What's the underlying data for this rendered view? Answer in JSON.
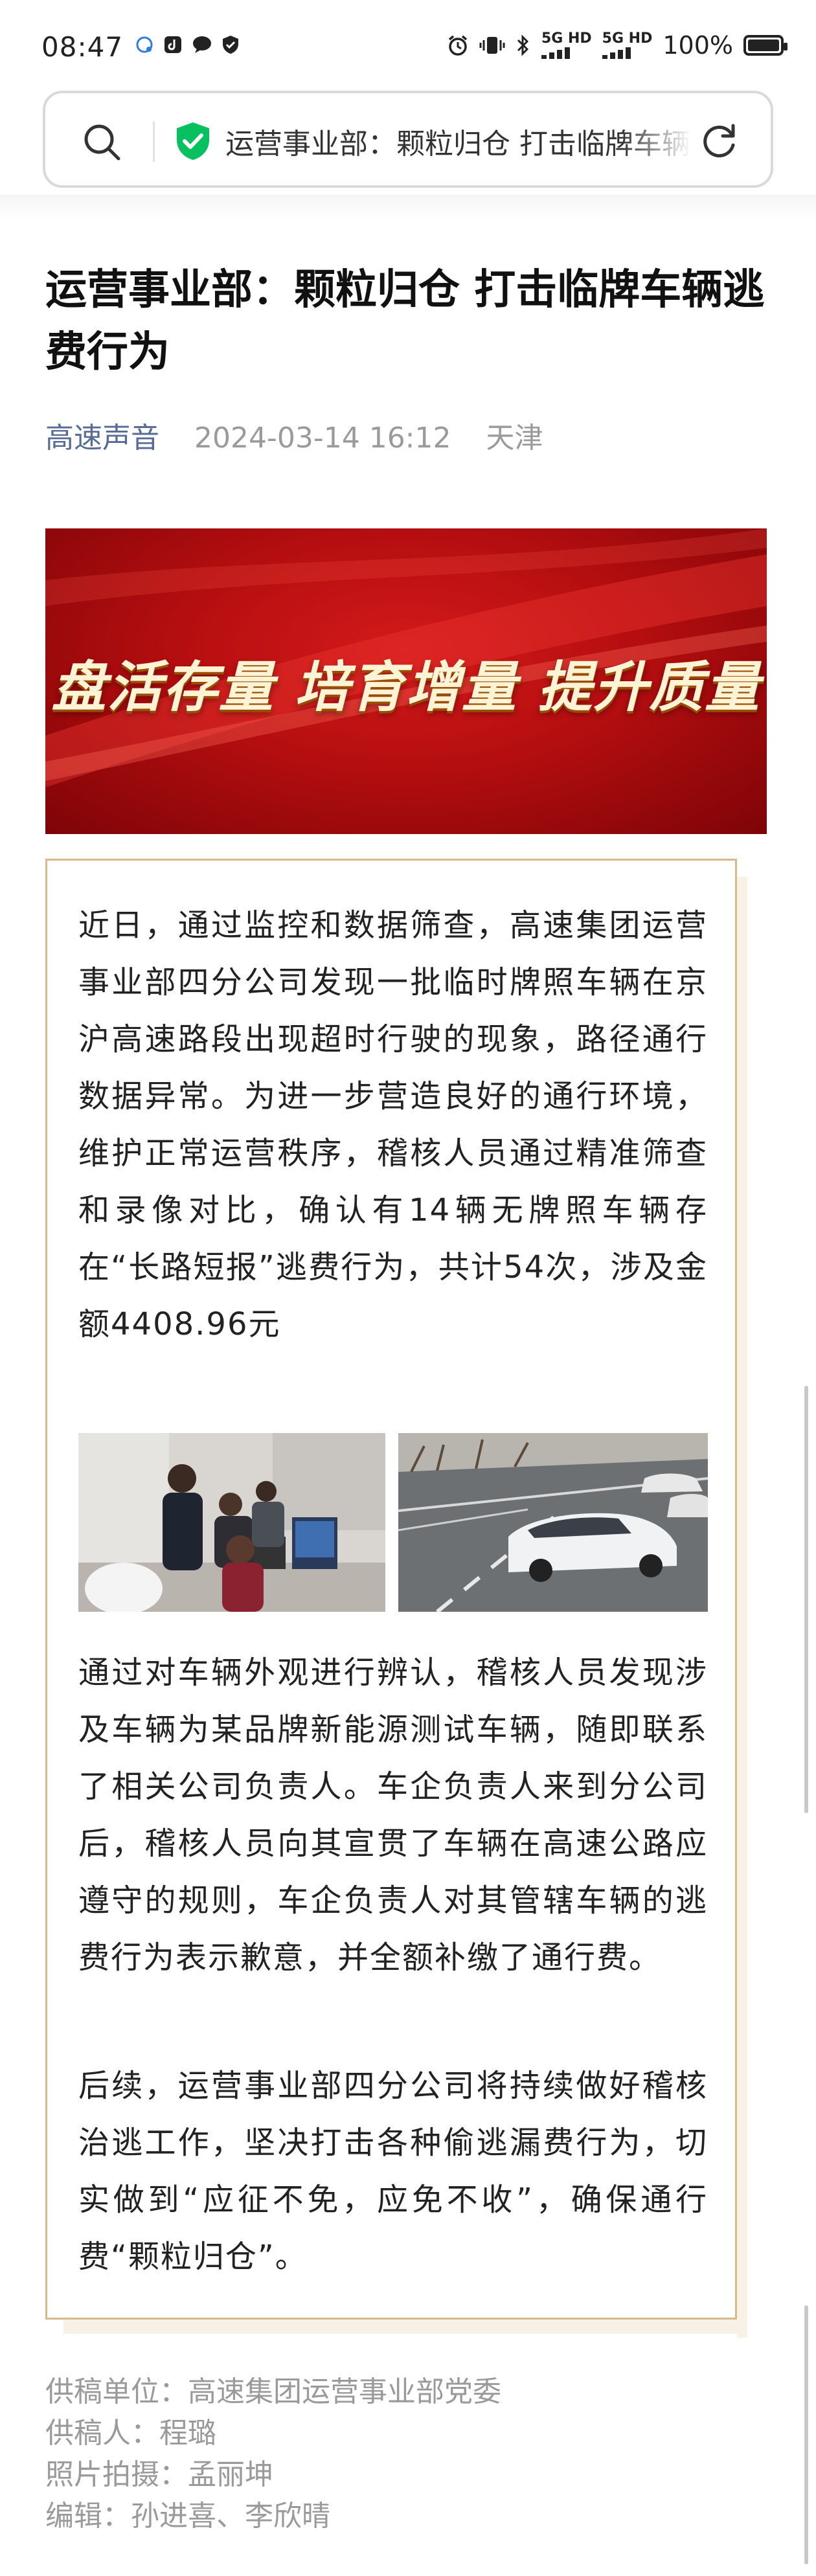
{
  "status_bar": {
    "time": "08:47",
    "network_5g_1": "5G HD",
    "network_5g_2": "5G HD",
    "battery": "100%",
    "battery_level": 1.0,
    "icons": [
      "chat-bubble-icon",
      "tiktok-icon",
      "message-icon",
      "shield-status-icon",
      "alarm-icon",
      "vibrate-icon",
      "bluetooth-icon"
    ]
  },
  "address_bar": {
    "text": "运营事业部：颗粒归仓 打击临牌车辆逃费行为",
    "secure_color": "#07c160",
    "icons": [
      "search-icon",
      "shield-check-icon",
      "reload-icon"
    ]
  },
  "article": {
    "title": "运营事业部：颗粒归仓 打击临牌车辆逃费行为",
    "source": "高速声音",
    "date": "2024-03-14 16:12",
    "location": "天津",
    "banner_text": "盘活存量 培育增量 提升质量",
    "paragraphs": [
      "近日，通过监控和数据筛查，高速集团运营事业部四分公司发现一批临时牌照车辆在京沪高速路段出现超时行驶的现象，路径通行数据异常。为进一步营造良好的通行环境，维护正常运营秩序，稽核人员通过精准筛查和录像对比，确认有14辆无牌照车辆存在“长路短报”逃费行为，共计54次，涉及金额4408.96元",
      "通过对车辆外观进行辨认，稽核人员发现涉及车辆为某品牌新能源测试车辆，随即联系了相关公司负责人。车企负责人来到分公司后，稽核人员向其宣贯了车辆在高速公路应遵守的规则，车企负责人对其管辖车辆的逃费行为表示歉意，并全额补缴了通行费。",
      "后续，运营事业部四分公司将持续做好稽核治逃工作，坚决打击各种偷逃漏费行为，切实做到“应征不免，应免不收”，确保通行费“颗粒归仓”。"
    ],
    "credits": [
      "供稿单位：高速集团运营事业部党委",
      "供稿人：程璐",
      "照片拍摄：孟丽坤",
      "编辑：孙进喜、李欣晴"
    ],
    "colors": {
      "source_link": "#576b95",
      "frame_border": "#d8b98a",
      "banner_red": "#c8141a"
    }
  }
}
